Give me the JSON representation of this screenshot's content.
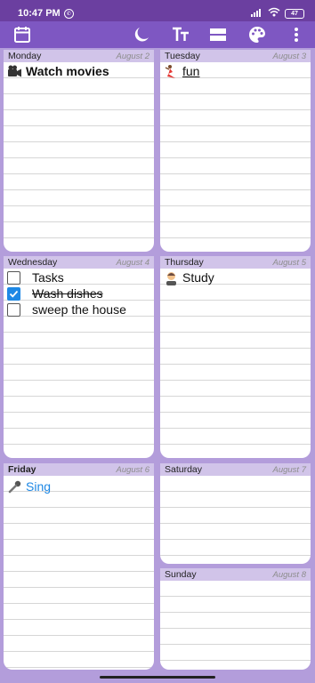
{
  "status_bar": {
    "time": "10:47 PM",
    "battery": "47"
  },
  "toolbar": {
    "icons": [
      "calendar-icon",
      "moon-icon",
      "text-size-icon",
      "layout-icon",
      "palette-icon",
      "more-vert-icon"
    ]
  },
  "days": {
    "monday": {
      "name": "Monday",
      "date": "August 2",
      "entries": [
        {
          "icon": "video-camera-emoji",
          "text": "Watch movies"
        }
      ]
    },
    "tuesday": {
      "name": "Tuesday",
      "date": "August 3",
      "entries": [
        {
          "icon": "dancer-emoji",
          "text": "fun"
        }
      ]
    },
    "wednesday": {
      "name": "Wednesday",
      "date": "August 4",
      "entries": [
        {
          "checked": false,
          "text": "Tasks"
        },
        {
          "checked": true,
          "text": "Wash dishes"
        },
        {
          "checked": false,
          "text": "sweep the house"
        }
      ]
    },
    "thursday": {
      "name": "Thursday",
      "date": "August 5",
      "entries": [
        {
          "icon": "student-emoji",
          "text": "Study"
        }
      ]
    },
    "friday": {
      "name": "Friday",
      "date": "August 6",
      "entries": [
        {
          "icon": "microphone-emoji",
          "text": "Sing"
        }
      ]
    },
    "saturday": {
      "name": "Saturday",
      "date": "August 7",
      "entries": []
    },
    "sunday": {
      "name": "Sunday",
      "date": "August 8",
      "entries": []
    }
  },
  "colors": {
    "accent": "#7e57c2",
    "background": "#b39ddb",
    "header": "#d1c4e9",
    "link_blue": "#1e88e5"
  }
}
